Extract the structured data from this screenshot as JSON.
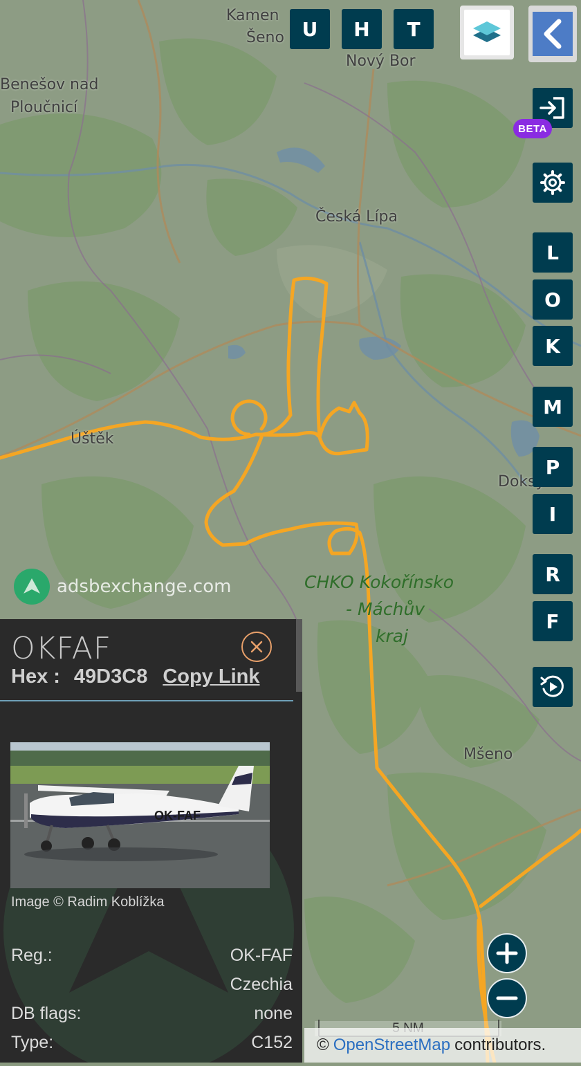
{
  "top_buttons": [
    {
      "label": "U"
    },
    {
      "label": "H"
    },
    {
      "label": "T"
    }
  ],
  "side_buttons": [
    {
      "label": "L"
    },
    {
      "label": "O"
    },
    {
      "label": "K"
    },
    {
      "label": "M"
    },
    {
      "label": "P"
    },
    {
      "label": "I"
    },
    {
      "label": "R"
    },
    {
      "label": "F"
    }
  ],
  "icons": {
    "layers": "layers-icon",
    "back": "chevron-left-icon",
    "login": "login-arrow-icon",
    "settings": "gear-icon",
    "replay": "replay-icon",
    "zoom_in": "plus-icon",
    "zoom_out": "minus-icon",
    "close": "close-circle-icon"
  },
  "beta_badge": "BETA",
  "map": {
    "labels": {
      "kamenicky_senov_1": "Kamen",
      "kamenicky_senov_2": "Šeno",
      "novy_bor": "Nový Bor",
      "benesov_1": "Benešov nad",
      "benesov_2": "Ploučnicí",
      "ceska_lipa": "Česká Lípa",
      "ustek": "Úštěk",
      "doksy": "Doksy",
      "mseno": "Mšeno",
      "chko_1": "CHKO Kokořínsko",
      "chko_2": "- Máchův",
      "chko_3": "kraj"
    },
    "track_color": "#f5a623",
    "scale_label": "5 NM"
  },
  "watermark": "adsbexchange.com",
  "attribution": {
    "prefix": "©",
    "link": "OpenStreetMap",
    "suffix": "contributors."
  },
  "panel": {
    "callsign": "OKFAF",
    "hex_label": "Hex :",
    "hex_value": "49D3C8",
    "copy_link": "Copy Link",
    "photo_credit": "Image © Radim Koblížka",
    "aircraft_marking": "OK-FAF",
    "rows": [
      {
        "label": "Reg.:",
        "value": "OK-FAF"
      },
      {
        "label": "",
        "value": "Czechia"
      },
      {
        "label": "DB flags:",
        "value": "none"
      },
      {
        "label": "Type:",
        "value": "C152"
      }
    ]
  },
  "colors": {
    "button_bg": "#003c4f",
    "beta": "#8a2be2",
    "panel_bg": "#2a2a2a",
    "link_blue": "#2b6fc1"
  }
}
